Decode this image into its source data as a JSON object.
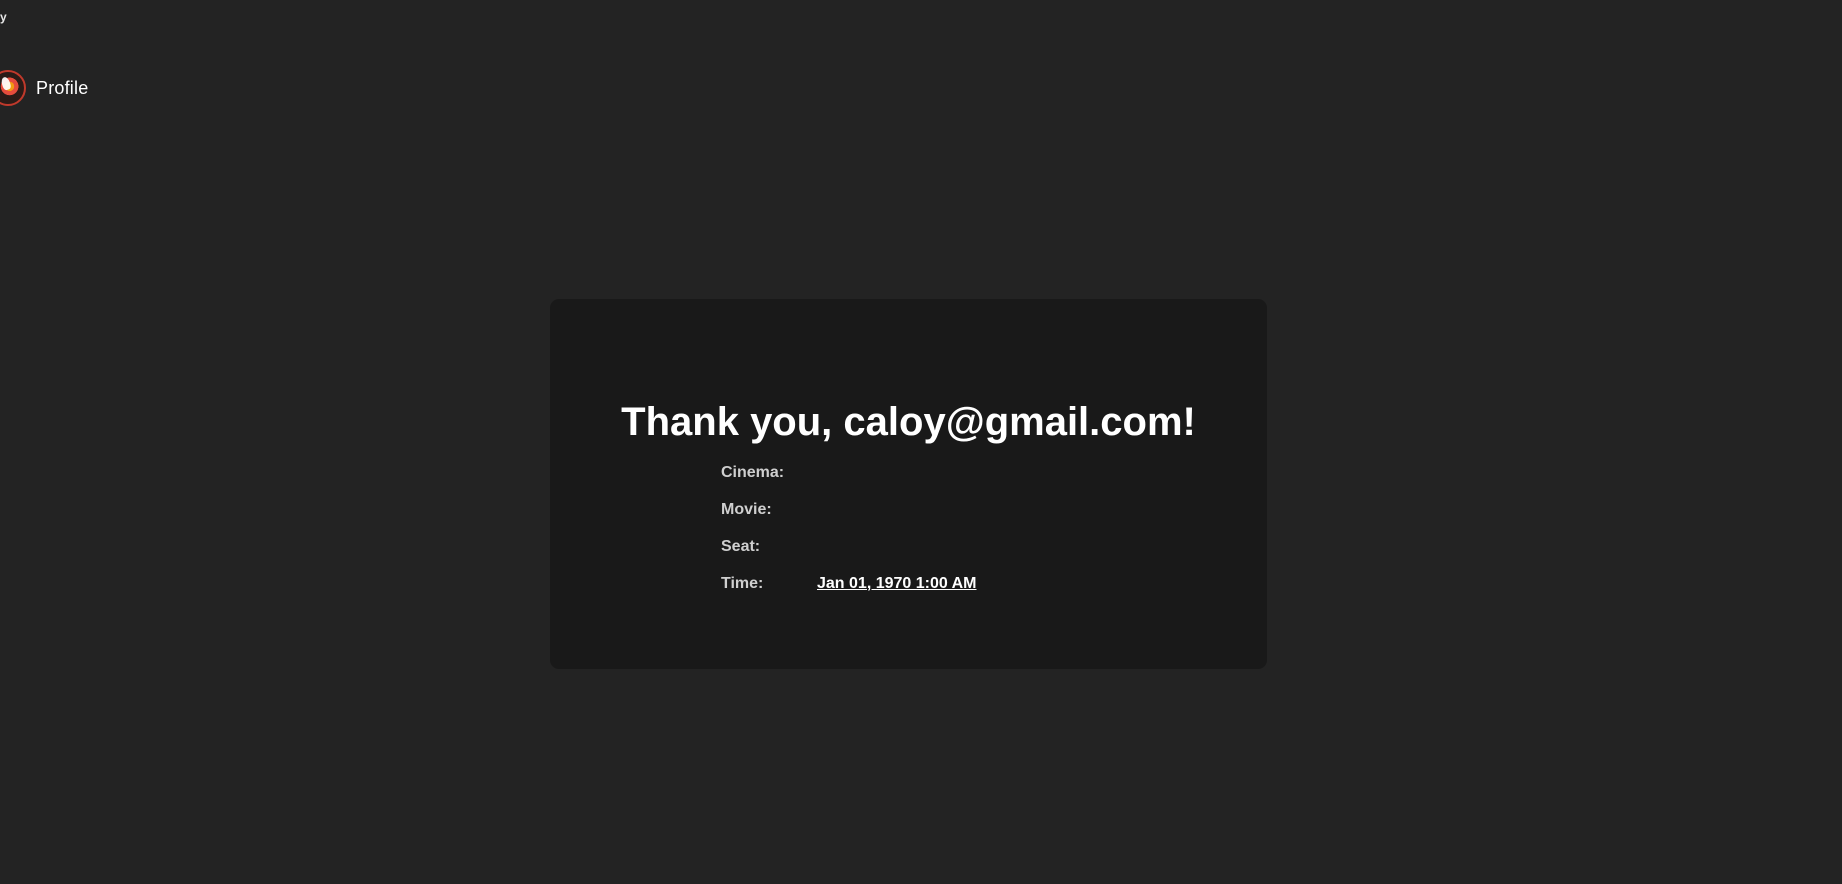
{
  "header": {
    "top_fragment": "y",
    "profile_label": "Profile"
  },
  "confirmation": {
    "title": "Thank you, caloy@gmail.com!",
    "details": [
      {
        "label": "Cinema:",
        "value": ""
      },
      {
        "label": "Movie:",
        "value": ""
      },
      {
        "label": "Seat:",
        "value": ""
      },
      {
        "label": "Time:",
        "value": "Jan 01, 1970 1:00 AM"
      }
    ]
  }
}
